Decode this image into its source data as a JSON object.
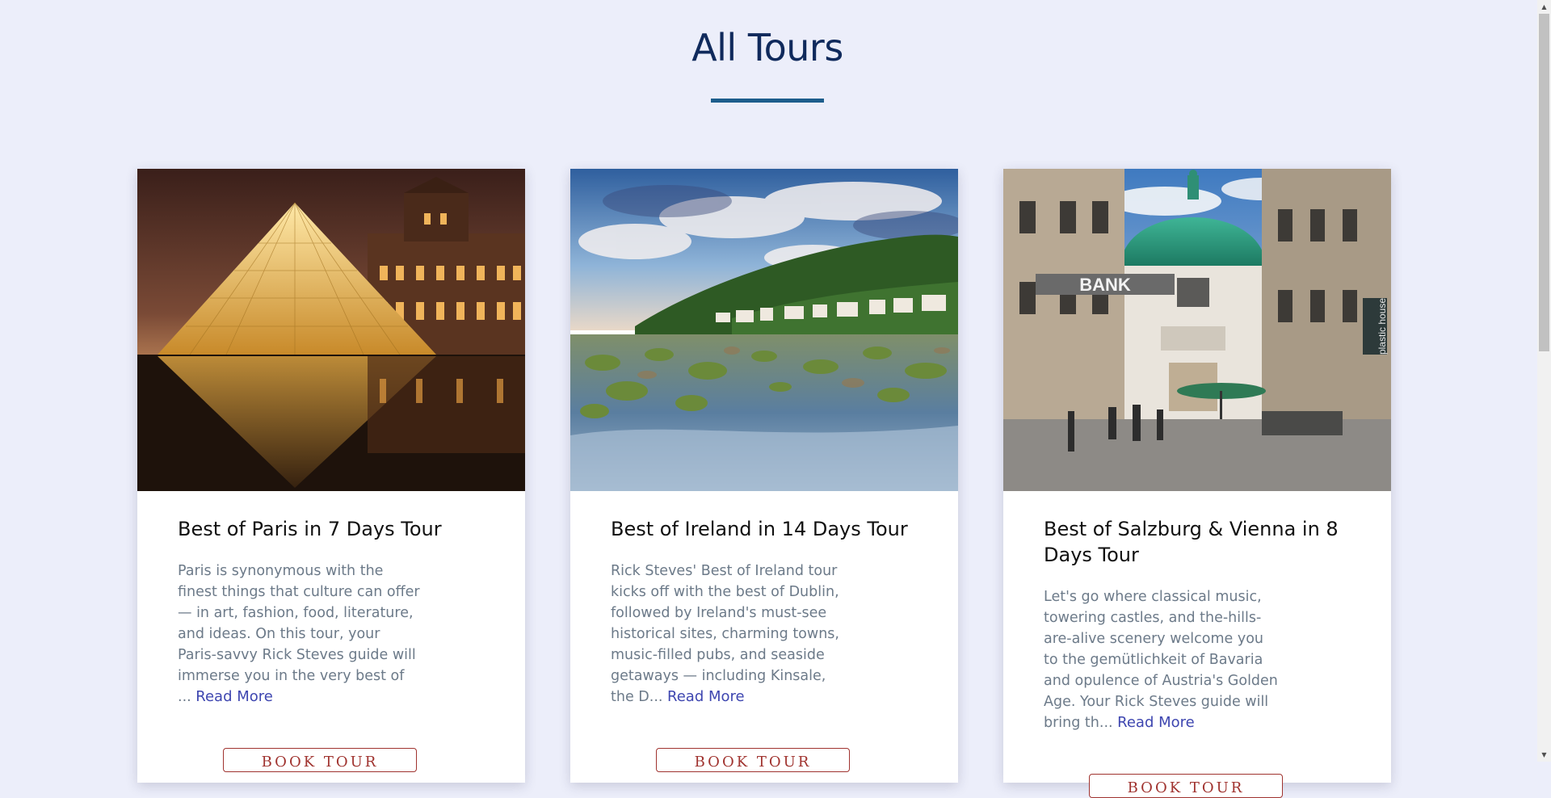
{
  "header": {
    "title": "All Tours"
  },
  "tours": [
    {
      "title": "Best of Paris in 7 Days Tour",
      "description": "Paris is synonymous with the finest things that culture can offer — in art, fashion, food, literature, and ideas. On this tour, your Paris-savvy Rick Steves guide will immerse you in the very best of ...",
      "read_more": "Read More",
      "button_label": "Book Tour"
    },
    {
      "title": "Best of Ireland in 14 Days Tour",
      "description": "Rick Steves' Best of Ireland tour kicks off with the best of Dublin, followed by Ireland's must-see historical sites, charming towns, music-filled pubs, and seaside getaways — including Kinsale, the D...",
      "read_more": "Read More",
      "button_label": "Book Tour"
    },
    {
      "title": "Best of Salzburg & Vienna in 8 Days Tour",
      "description": "Let's go where classical music, towering castles, and the-hills-are-alive scenery welcome you to the gemütlichkeit of Bavaria and opulence of Austria's Golden Age. Your Rick Steves guide will bring th...",
      "read_more": "Read More",
      "button_label": "Book Tour",
      "image_signs": [
        "BANK",
        "plastic house"
      ]
    }
  ],
  "colors": {
    "background": "#eceefa",
    "title": "#102a5c",
    "accent_rule": "#1d5d8c",
    "link": "#3e46b0",
    "button_border": "#a0332f"
  }
}
